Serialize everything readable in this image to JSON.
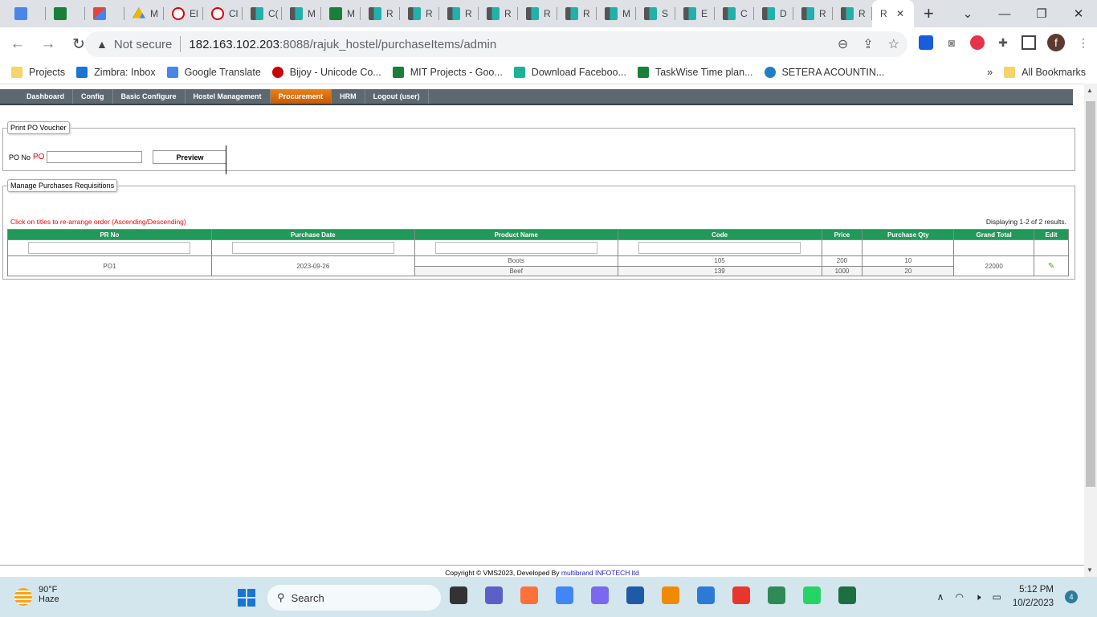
{
  "browser": {
    "tabs": [
      {
        "icon": "gt",
        "label": ""
      },
      {
        "icon": "sheets",
        "label": ""
      },
      {
        "icon": "gmail",
        "label": ""
      },
      {
        "icon": "drive",
        "label": "M"
      },
      {
        "icon": "red",
        "label": "El"
      },
      {
        "icon": "red",
        "label": "Cl"
      },
      {
        "icon": "app",
        "label": "C("
      },
      {
        "icon": "app",
        "label": "M"
      },
      {
        "icon": "sheets",
        "label": "M"
      },
      {
        "icon": "app",
        "label": "R"
      },
      {
        "icon": "app",
        "label": "R"
      },
      {
        "icon": "app",
        "label": "R"
      },
      {
        "icon": "app",
        "label": "R"
      },
      {
        "icon": "app",
        "label": "R"
      },
      {
        "icon": "app",
        "label": "R"
      },
      {
        "icon": "app",
        "label": "M"
      },
      {
        "icon": "app",
        "label": "S"
      },
      {
        "icon": "app",
        "label": "E"
      },
      {
        "icon": "app",
        "label": "C"
      },
      {
        "icon": "app",
        "label": "D"
      },
      {
        "icon": "app",
        "label": "R"
      },
      {
        "icon": "app",
        "label": "R"
      }
    ],
    "active_tab": "R",
    "security": "Not secure",
    "url_host": "182.163.102.203",
    "url_rest": ":8088/rajuk_hostel/purchaseItems/admin",
    "profile_initial": "f",
    "bookmarks": [
      {
        "icon": "folder",
        "label": "Projects"
      },
      {
        "icon": "zimbra",
        "label": "Zimbra: Inbox"
      },
      {
        "icon": "gt",
        "label": "Google Translate"
      },
      {
        "icon": "bijoy",
        "label": "Bijoy - Unicode Co..."
      },
      {
        "icon": "sheets",
        "label": "MIT Projects - Goo..."
      },
      {
        "icon": "fb",
        "label": "Download Faceboo..."
      },
      {
        "icon": "sheets",
        "label": "TaskWise Time plan..."
      },
      {
        "icon": "gear",
        "label": "SETERA ACOUNTIN..."
      }
    ],
    "all_bookmarks": "All Bookmarks"
  },
  "menu": [
    "Dashboard",
    "Config",
    "Basic Configure",
    "Hostel Management",
    "Procurement",
    "HRM",
    "Logout (user)"
  ],
  "menu_active": "Procurement",
  "print_voucher": {
    "legend": "Print PO Voucher",
    "label": "PO No",
    "required_marker": "PO",
    "input_value": "",
    "button": "Preview"
  },
  "requisitions": {
    "legend": "Manage Purchases Requisitions",
    "hint": "Click on titles to re-arrange order (Ascending/Descending)",
    "summary": "Displaying 1-2 of 2 results.",
    "columns": [
      "PR No",
      "Purchase Date",
      "Product Name",
      "Code",
      "Price",
      "Purchase Qty",
      "Grand Total",
      "Edit"
    ],
    "rows": [
      {
        "pr_no": "PO1",
        "date": "2023-09-26",
        "grand_total": "22000",
        "items": [
          {
            "product": "Boots",
            "code": "105",
            "price": "200",
            "qty": "10"
          },
          {
            "product": "Beef",
            "code": "139",
            "price": "1000",
            "qty": "20"
          }
        ]
      }
    ]
  },
  "footer": {
    "text": "Copyright © VMS2023, Developed By ",
    "link": "multibrand INFOTECH ltd"
  },
  "taskbar": {
    "temp": "90°F",
    "weather": "Haze",
    "search": "Search",
    "time": "5:12 PM",
    "date": "10/2/2023",
    "notifications": "4",
    "apps": [
      "#333",
      "#5b5fc7",
      "#ff7139",
      "#4285f4",
      "#7b68ee",
      "#1e5aa8",
      "#f08a00",
      "#2b7bd6",
      "#e8362d",
      "#2e8b57",
      "#25d366",
      "#1d6f42"
    ]
  }
}
